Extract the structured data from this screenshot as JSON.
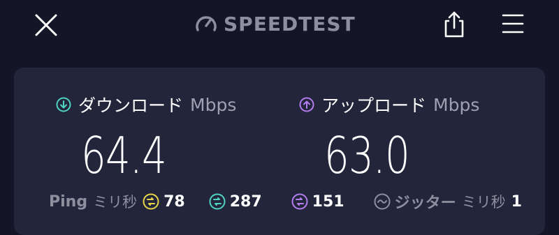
{
  "header": {
    "logo_text": "SPEEDTEST",
    "icons": [
      "close-icon",
      "speedometer-icon",
      "share-icon",
      "menu-icon"
    ]
  },
  "download": {
    "label": "ダウンロード",
    "unit": "Mbps",
    "value": "64.4",
    "icon": "arrow-down-circle-icon",
    "color": "#4fd4c4"
  },
  "upload": {
    "label": "アップロード",
    "unit": "Mbps",
    "value": "63.0",
    "icon": "arrow-up-circle-icon",
    "color": "#b57cf0"
  },
  "ping": {
    "label": "Ping",
    "unit": "ミリ秒",
    "idle": {
      "value": "78",
      "color": "#e8d54a"
    },
    "download": {
      "value": "287",
      "color": "#4fd4c4"
    },
    "upload": {
      "value": "151",
      "color": "#b57cf0"
    }
  },
  "jitter": {
    "label": "ジッター",
    "unit": "ミリ秒",
    "value": "1",
    "icon": "jitter-wave-icon"
  },
  "colors": {
    "background": "#141526",
    "card": "#23253a",
    "muted": "#8e90a0"
  }
}
